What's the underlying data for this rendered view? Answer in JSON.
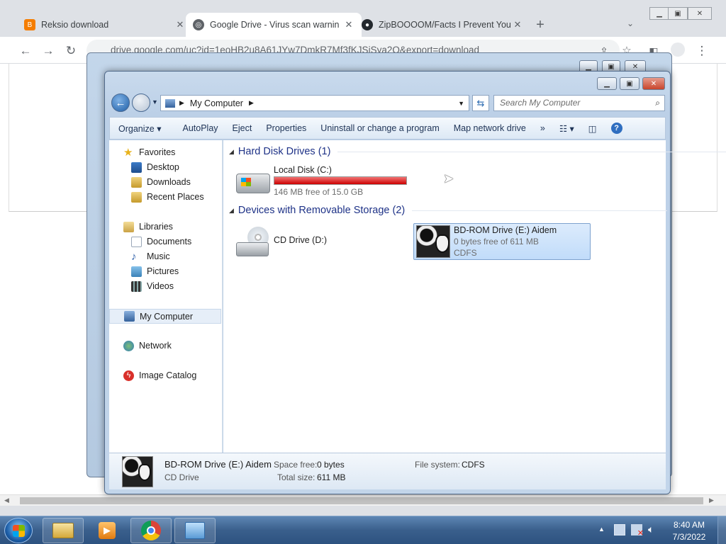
{
  "browser": {
    "tabs": [
      {
        "title": "Reksio download",
        "icon": "blogger-icon",
        "active": false
      },
      {
        "title": "Google Drive - Virus scan warnin",
        "icon": "google-drive-icon",
        "active": true
      },
      {
        "title": "ZipBOOOOM/Facts I Prevent You",
        "icon": "github-icon",
        "active": false
      }
    ],
    "new_tab": "+",
    "address": "drive.google.com/uc?id=1eoHB2u8A61JYw7DmkR7Mf3fKJSiSya2Q&export=download"
  },
  "explorer": {
    "address_path": "My Computer",
    "search_placeholder": "Search My Computer",
    "commands": [
      "Organize",
      "AutoPlay",
      "Eject",
      "Properties",
      "Uninstall or change a program",
      "Map network drive"
    ],
    "more": "»",
    "nav": {
      "favorites": "Favorites",
      "favorites_items": [
        "Desktop",
        "Downloads",
        "Recent Places"
      ],
      "libraries": "Libraries",
      "libraries_items": [
        "Documents",
        "Music",
        "Pictures",
        "Videos"
      ],
      "computer": "My Computer",
      "network": "Network",
      "image_catalog": "Image Catalog"
    },
    "groups": {
      "hdd": "Hard Disk Drives (1)",
      "removable": "Devices with Removable Storage (2)"
    },
    "drives": {
      "c": {
        "name": "Local Disk (C:)",
        "free": "146 MB free of 15.0 GB",
        "used_fraction": 0.99
      },
      "d": {
        "name": "CD Drive (D:)"
      },
      "e": {
        "name": "BD-ROM Drive (E:) Aidem",
        "free": "0 bytes free of 611 MB",
        "fs": "CDFS"
      }
    },
    "details": {
      "name": "BD-ROM Drive (E:) Aidem",
      "type": "CD Drive",
      "space_free_label": "Space free:",
      "space_free": "0 bytes",
      "total_size_label": "Total size:",
      "total_size": "611 MB",
      "fs_label": "File system:",
      "fs": "CDFS"
    }
  },
  "taskbar": {
    "time": "8:40 AM",
    "date": "7/3/2022",
    "show_hidden": "▲"
  }
}
